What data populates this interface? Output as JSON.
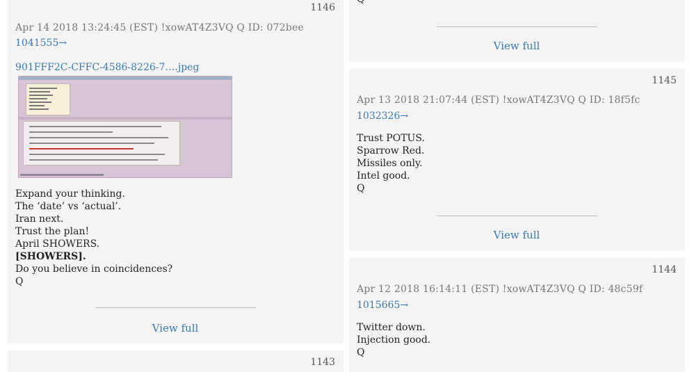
{
  "posts": [
    {
      "number": "1146",
      "meta": "Apr 14 2018 13:24:45 (EST) !xowAT4Z3VQ Q ID: 072bee",
      "ref_link": "1041555→",
      "file_link": "901FFF2C-CFFC-4586-8226-7….jpeg",
      "lines": [
        "Expand your thinking.",
        "The ‘date’ vs ‘actual’.",
        "Iran next.",
        "Trust the plan!",
        "April SHOWERS.",
        "[SHOWERS].",
        "Do you believe in coincidences?",
        "Q"
      ],
      "view_full": "View full"
    },
    {
      "number": "1143"
    },
    {
      "top_text": "Q",
      "view_full": "View full"
    },
    {
      "number": "1145",
      "meta": "Apr 13 2018 21:07:44 (EST) !xowAT4Z3VQ Q ID: 18f5fc",
      "ref_link": "1032326→",
      "lines": [
        "Trust POTUS.",
        "Sparrow Red.",
        "Missiles only.",
        "Intel good.",
        "Q"
      ],
      "view_full": "View full"
    },
    {
      "number": "1144",
      "meta": "Apr 12 2018 16:14:11 (EST) !xowAT4Z3VQ Q ID: 48c59f",
      "ref_link": "1015665→",
      "lines": [
        "Twitter down.",
        "Injection good.",
        "Q"
      ]
    }
  ]
}
